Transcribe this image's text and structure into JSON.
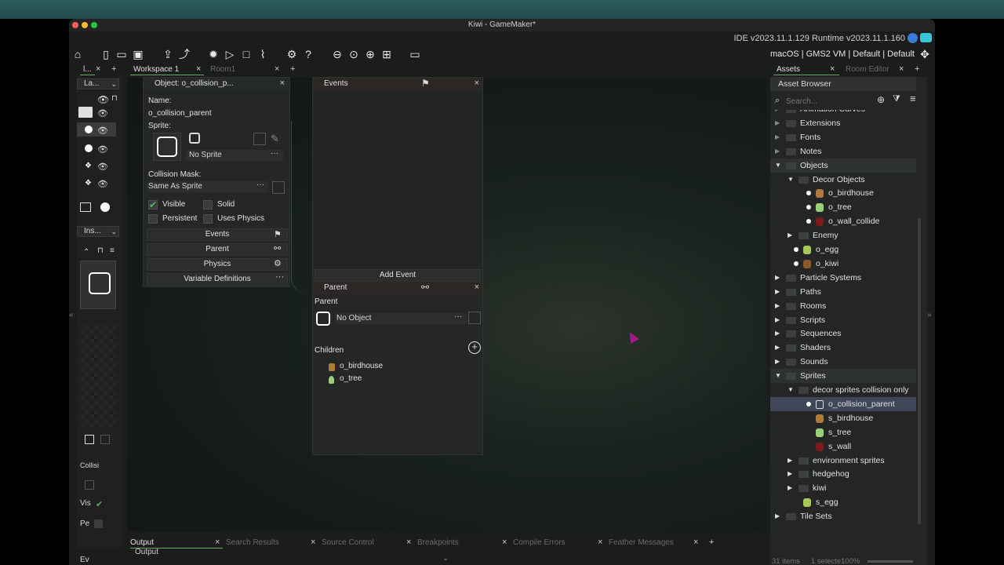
{
  "window": {
    "title": "Kiwi - GameMaker*"
  },
  "version": {
    "text": "IDE v2023.11.1.129  Runtime v2023.11.1.160"
  },
  "target": {
    "text": "macOS | GMS2 VM | Default | Default"
  },
  "left_tabs": {
    "first": "l...",
    "layers": "La...",
    "inspector": "Ins...",
    "collision_label": "Collisi",
    "vis_label": "Vis",
    "pe_label": "Pe",
    "ev_label": "Ev"
  },
  "tabs": {
    "workspace": "Workspace 1",
    "room": "Room1",
    "assets": "Assets",
    "room_editor": "Room Editor"
  },
  "object_panel": {
    "header": "Object: o_collision_p...",
    "name_label": "Name:",
    "name_value": "o_collision_parent",
    "sprite_label": "Sprite:",
    "sprite_value": "No Sprite",
    "mask_label": "Collision Mask:",
    "mask_value": "Same As Sprite",
    "visible": "Visible",
    "solid": "Solid",
    "persistent": "Persistent",
    "uses_physics": "Uses Physics",
    "events_btn": "Events",
    "parent_btn": "Parent",
    "physics_btn": "Physics",
    "vardefs_btn": "Variable Definitions",
    "ellipsis": "···"
  },
  "events_panel": {
    "header": "Events",
    "add_event": "Add Event"
  },
  "parent_panel": {
    "header": "Parent",
    "parent_label": "Parent",
    "parent_value": "No Object",
    "children_label": "Children",
    "children": [
      "o_birdhouse",
      "o_tree"
    ]
  },
  "asset_browser": {
    "header": "Asset Browser",
    "search_placeholder": "Search...",
    "items": [
      {
        "label": "Animation Curves",
        "kind": "folder-closed",
        "indent": 0
      },
      {
        "label": "Extensions",
        "kind": "folder-closed",
        "indent": 0
      },
      {
        "label": "Fonts",
        "kind": "folder-closed",
        "indent": 0
      },
      {
        "label": "Notes",
        "kind": "folder-closed",
        "indent": 0
      },
      {
        "label": "Objects",
        "kind": "folder-open",
        "indent": 0
      },
      {
        "label": "Decor Objects",
        "kind": "folder-open",
        "indent": 1
      },
      {
        "label": "o_birdhouse",
        "kind": "asset",
        "indent": 2,
        "color": "#b07a3a"
      },
      {
        "label": "o_tree",
        "kind": "asset",
        "indent": 2,
        "color": "#9bd07a"
      },
      {
        "label": "o_wall_collide",
        "kind": "asset",
        "indent": 2,
        "color": "#7a1c1c"
      },
      {
        "label": "Enemy",
        "kind": "folder-closed",
        "indent": 1
      },
      {
        "label": "o_egg",
        "kind": "asset",
        "indent": 1,
        "color": "#a8c85a"
      },
      {
        "label": "o_kiwi",
        "kind": "asset",
        "indent": 1,
        "color": "#8a5a2a"
      },
      {
        "label": "Particle Systems",
        "kind": "folder-closed",
        "indent": 0
      },
      {
        "label": "Paths",
        "kind": "folder-closed",
        "indent": 0
      },
      {
        "label": "Rooms",
        "kind": "folder-closed",
        "indent": 0
      },
      {
        "label": "Scripts",
        "kind": "folder-closed",
        "indent": 0
      },
      {
        "label": "Sequences",
        "kind": "folder-closed",
        "indent": 0
      },
      {
        "label": "Shaders",
        "kind": "folder-closed",
        "indent": 0
      },
      {
        "label": "Sounds",
        "kind": "folder-closed",
        "indent": 0
      },
      {
        "label": "Sprites",
        "kind": "folder-open",
        "indent": 0
      },
      {
        "label": "decor sprites collision only",
        "kind": "folder-open",
        "indent": 1
      },
      {
        "label": "o_collision_parent",
        "kind": "asset-selected",
        "indent": 2,
        "color": "#dddddd"
      },
      {
        "label": "s_birdhouse",
        "kind": "asset-nodot",
        "indent": 2,
        "color": "#b07a3a"
      },
      {
        "label": "s_tree",
        "kind": "asset-nodot",
        "indent": 2,
        "color": "#9bd07a"
      },
      {
        "label": "s_wall",
        "kind": "asset-nodot",
        "indent": 2,
        "color": "#7a1c1c"
      },
      {
        "label": "environment sprites",
        "kind": "folder-closed",
        "indent": 1
      },
      {
        "label": "hedgehog",
        "kind": "folder-closed",
        "indent": 1
      },
      {
        "label": "kiwi",
        "kind": "folder-closed",
        "indent": 1
      },
      {
        "label": "s_egg",
        "kind": "asset-nodot",
        "indent": 1,
        "color": "#a8c85a"
      },
      {
        "label": "Tile Sets",
        "kind": "folder-closed",
        "indent": 0
      }
    ],
    "footer_count": "31 items",
    "footer_sel": "1 selecte100%"
  },
  "bottom_tabs": {
    "output": "Output",
    "search": "Search Results",
    "source": "Source Control",
    "breakpoints": "Breakpoints",
    "compile": "Compile Errors",
    "feather": "Feather Messages",
    "output_title": "Output"
  },
  "colors": {
    "accent_green": "#5fae5f",
    "selection": "#3e4657",
    "cursor": "#a01a8a"
  }
}
